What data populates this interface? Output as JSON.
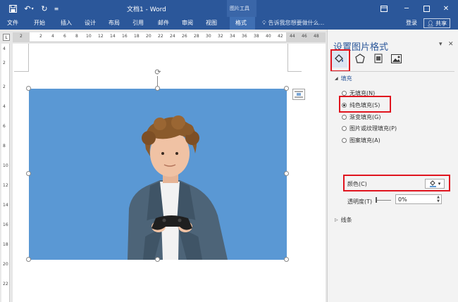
{
  "titlebar": {
    "save_icon": "save-icon",
    "undo_icon": "undo-icon",
    "redo_icon": "redo-icon",
    "customize_icon": "customize-icon",
    "doc_title": "文档1 - Word",
    "context_tab_group": "图片工具"
  },
  "tabs": [
    "文件",
    "开始",
    "插入",
    "设计",
    "布局",
    "引用",
    "邮件",
    "审阅",
    "视图"
  ],
  "active_tab": "格式",
  "tell_me": "告诉我您想要做什么...",
  "login": "登录",
  "share": "共享",
  "ruler": {
    "numbers": [
      "2",
      "2",
      "4",
      "6",
      "8",
      "10",
      "12",
      "14",
      "16",
      "18",
      "20",
      "22",
      "24",
      "26",
      "28",
      "30",
      "32",
      "34",
      "36",
      "38",
      "40",
      "42",
      "44",
      "46",
      "48"
    ],
    "vertical_numbers": [
      "4",
      "2",
      "2",
      "4",
      "6",
      "8",
      "10",
      "12",
      "14",
      "16",
      "18",
      "20",
      "22"
    ]
  },
  "pane": {
    "title": "设置图片格式",
    "fill_section": "填充",
    "fill_options": [
      {
        "label": "无填充(N)",
        "checked": false
      },
      {
        "label": "纯色填充(S)",
        "checked": true
      },
      {
        "label": "渐变填充(G)",
        "checked": false
      },
      {
        "label": "图片或纹理填充(P)",
        "checked": false
      },
      {
        "label": "图案填充(A)",
        "checked": false
      }
    ],
    "color_label": "颜色(C)",
    "transparency_label": "透明度(T)",
    "transparency_value": "0%",
    "line_section": "线条"
  },
  "colors": {
    "ribbon": "#2b579a",
    "image_bg": "#5a98d4",
    "highlight": "#e0141e"
  }
}
